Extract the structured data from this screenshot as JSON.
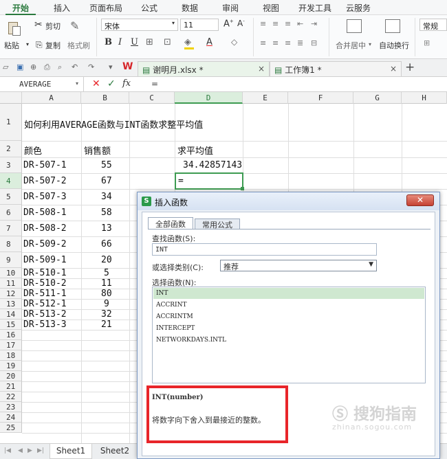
{
  "ribbon_tabs": [
    "开始",
    "插入",
    "页面布局",
    "公式",
    "数据",
    "审阅",
    "视图",
    "开发工具",
    "云服务"
  ],
  "ribbon": {
    "paste": "粘贴",
    "cut": "剪切",
    "copy": "复制",
    "format_painter": "格式刷",
    "font_name": "宋体",
    "font_size": "11",
    "merge_center": "合并居中",
    "wrap_text": "自动换行",
    "number_format": "常规"
  },
  "doc_tabs": [
    {
      "label": "谢明月.xlsx *"
    },
    {
      "label": "工作簿1 *"
    }
  ],
  "formula_bar": {
    "name_box": "AVERAGE",
    "fx": "fx",
    "content": "="
  },
  "columns": [
    "A",
    "B",
    "C",
    "D",
    "E",
    "F",
    "G",
    "H"
  ],
  "rows": [
    "1",
    "2",
    "3",
    "4",
    "5",
    "6",
    "7",
    "8",
    "9",
    "10",
    "11",
    "12",
    "13",
    "14",
    "15",
    "16",
    "17",
    "18",
    "19",
    "20",
    "21",
    "22",
    "23",
    "24",
    "25"
  ],
  "cells": {
    "title": "如何利用AVERAGE函数与INT函数求整平均值",
    "header_a": "颜色",
    "header_b": "销售额",
    "header_d": "求平均值",
    "d3": "34.42857143",
    "d4": "=",
    "a": [
      "DR-507-1",
      "DR-507-2",
      "DR-507-3",
      "DR-508-1",
      "DR-508-2",
      "DR-509-2",
      "DR-509-1",
      "DR-510-1",
      "DR-510-2",
      "DR-511-1",
      "DR-512-1",
      "DR-513-2",
      "DR-513-3"
    ],
    "b": [
      "55",
      "67",
      "34",
      "58",
      "13",
      "66",
      "20",
      "5",
      "11",
      "80",
      "9",
      "32",
      "21"
    ]
  },
  "sheets": [
    "Sheet1",
    "Sheet2"
  ],
  "dialog": {
    "title": "插入函数",
    "tabs": [
      "全部函数",
      "常用公式"
    ],
    "search_label": "查找函数(S):",
    "search_value": "INT",
    "category_label": "或选择类别(C):",
    "category_value": "推荐",
    "select_label": "选择函数(N):",
    "functions": [
      "INT",
      "ACCRINT",
      "ACCRINTM",
      "INTERCEPT",
      "NETWORKDAYS.INTL"
    ],
    "signature": "INT(number)",
    "description": "将数字向下舍入到最接近的整数。"
  },
  "watermark": {
    "brand": "搜狗指南",
    "url": "zhinan.sogou.com"
  },
  "colors": {
    "accent_green": "#2b7a3e",
    "selection_green": "#3d9b51",
    "highlight_red": "#e8252a"
  }
}
